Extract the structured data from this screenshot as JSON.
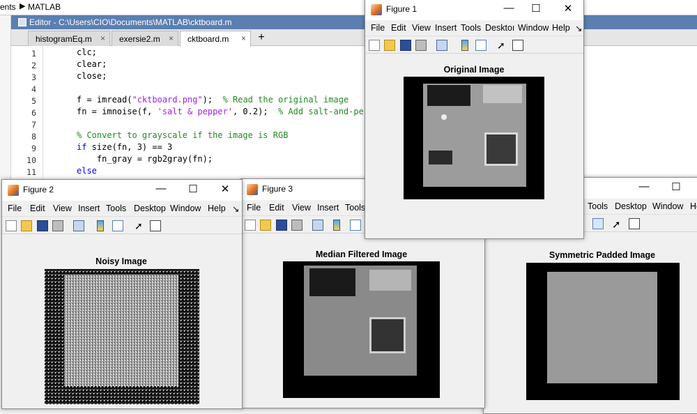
{
  "crumbs": {
    "first": "ents",
    "sep": "▶",
    "second": "MATLAB"
  },
  "editor": {
    "title": "Editor - C:\\Users\\CIO\\Documents\\MATLAB\\cktboard.m",
    "tabs": [
      {
        "label": "histogramEq.m",
        "close": "×"
      },
      {
        "label": "exersie2.m",
        "close": "×"
      },
      {
        "label": "cktboard.m",
        "close": "×"
      }
    ],
    "add_tab": "+",
    "line_numbers": [
      "1",
      "2",
      "3",
      "4",
      "5",
      "6",
      "7",
      "8",
      "9",
      "10",
      "11"
    ],
    "lines": {
      "l1": "clc;",
      "l2": "clear;",
      "l3": "close;",
      "l5a": "f = imread(",
      "l5b": "\"cktboard.png\"",
      "l5c": ");  ",
      "l5d": "% Read the original image",
      "l6a": "fn = imnoise(f, ",
      "l6b": "'salt & pepper'",
      "l6c": ", 0.2);  ",
      "l6d": "% Add salt-and-pe",
      "l8": "% Convert to grayscale if the image is RGB",
      "l9a": "if",
      "l9b": " size(fn, 3) == 3",
      "l10": "    fn_gray = rgb2gray(fn);",
      "l11": "else"
    }
  },
  "menu": [
    "File",
    "Edit",
    "View",
    "Insert",
    "Tools",
    "Desktop",
    "Window",
    "Help"
  ],
  "menu_fig1": [
    "File",
    "Edit",
    "View",
    "Insert",
    "Tools",
    "Desktop",
    "Window",
    "Help"
  ],
  "menu_fig1_partial": {
    "desktop": "Desktoı",
    "window": "Window"
  },
  "menu_arrow": "↘",
  "window_controls": {
    "minimize": "—",
    "maximize": "☐",
    "close": "✕"
  },
  "figures": {
    "fig1": {
      "title": "Figure 1",
      "plot_title": "Original Image"
    },
    "fig2": {
      "title": "Figure 2",
      "plot_title": "Noisy Image"
    },
    "fig3": {
      "title": "Figure 3",
      "plot_title": "Median Filtered Image"
    },
    "fig4": {
      "title": "",
      "plot_title": "Symmetric Padded Image",
      "menu_partial": [
        "Tools",
        "Desktop",
        "Window",
        "He"
      ]
    }
  },
  "colors": {
    "editor_title": "#5b7fb0",
    "keyword": "#0000ff",
    "string": "#a020f0",
    "comment": "#228b22"
  }
}
